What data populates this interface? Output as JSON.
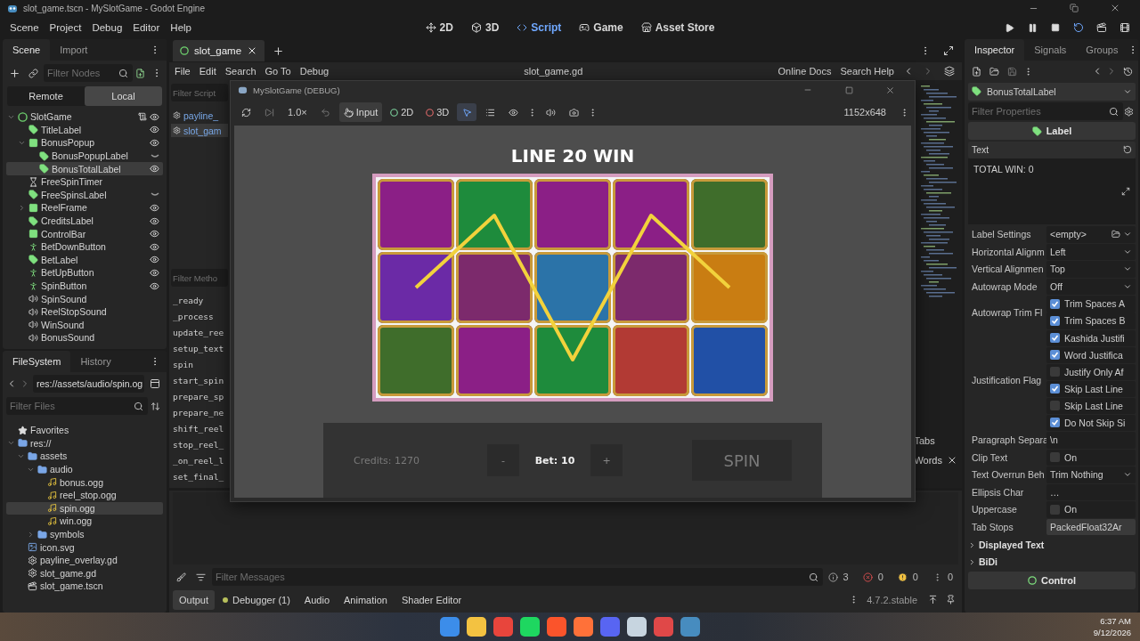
{
  "window": {
    "title": "slot_game.tscn - MySlotGame - Godot Engine"
  },
  "menu": [
    "Scene",
    "Project",
    "Debug",
    "Editor",
    "Help"
  ],
  "workspaces": [
    {
      "label": "2D",
      "kind": "planar",
      "selected": false
    },
    {
      "label": "3D",
      "kind": "spatial",
      "selected": false
    },
    {
      "label": "Script",
      "kind": "script",
      "selected": true
    },
    {
      "label": "Game",
      "kind": "game",
      "selected": false
    },
    {
      "label": "Asset Store",
      "kind": "store",
      "selected": false
    }
  ],
  "scene_dock": {
    "tabs": [
      {
        "label": "Scene",
        "selected": true
      },
      {
        "label": "Import",
        "selected": false
      }
    ],
    "filter_placeholder": "Filter Nodes",
    "modes": [
      {
        "label": "Remote",
        "selected": false
      },
      {
        "label": "Local",
        "selected": true
      }
    ],
    "tree": [
      {
        "name": "SlotGame",
        "kind": "root",
        "script": true,
        "visible": true,
        "expanded": true,
        "selected": false,
        "children": [
          {
            "name": "TitleLabel",
            "kind": "label",
            "visible": true,
            "selected": false
          },
          {
            "name": "BonusPopup",
            "kind": "control",
            "visible": true,
            "expanded": true,
            "selected": false,
            "children": [
              {
                "name": "BonusPopupLabel",
                "kind": "label",
                "visible": false,
                "selected": false
              },
              {
                "name": "BonusTotalLabel",
                "kind": "label",
                "visible": true,
                "selected": true
              }
            ]
          },
          {
            "name": "FreeSpinTimer",
            "kind": "timer",
            "selected": false
          },
          {
            "name": "FreeSpinsLabel",
            "kind": "label",
            "visible": false,
            "selected": false
          },
          {
            "name": "ReelFrame",
            "kind": "control",
            "visible": true,
            "expanded": false,
            "selected": false
          },
          {
            "name": "CreditsLabel",
            "kind": "label",
            "visible": true,
            "selected": false
          },
          {
            "name": "ControlBar",
            "kind": "control",
            "visible": true,
            "selected": false
          },
          {
            "name": "BetDownButton",
            "kind": "button",
            "visible": true,
            "selected": false
          },
          {
            "name": "BetLabel",
            "kind": "label",
            "visible": true,
            "selected": false
          },
          {
            "name": "BetUpButton",
            "kind": "button",
            "visible": true,
            "selected": false
          },
          {
            "name": "SpinButton",
            "kind": "button",
            "visible": true,
            "selected": false
          },
          {
            "name": "SpinSound",
            "kind": "sound",
            "selected": false
          },
          {
            "name": "ReelStopSound",
            "kind": "sound",
            "selected": false
          },
          {
            "name": "WinSound",
            "kind": "sound",
            "selected": false
          },
          {
            "name": "BonusSound",
            "kind": "sound",
            "selected": false
          }
        ]
      }
    ]
  },
  "file_dock": {
    "tabs": [
      {
        "label": "FileSystem",
        "selected": true
      },
      {
        "label": "History",
        "selected": false
      }
    ],
    "path": "res://assets/audio/spin.og",
    "filter_placeholder": "Filter Files",
    "tree": [
      {
        "name": "Favorites",
        "kind": "favorites",
        "selected": false
      },
      {
        "name": "res://",
        "kind": "folder",
        "expanded": true,
        "selected": false,
        "children": [
          {
            "name": "assets",
            "kind": "folder",
            "expanded": true,
            "selected": false,
            "children": [
              {
                "name": "audio",
                "kind": "folder",
                "expanded": true,
                "selected": false,
                "children": [
                  {
                    "name": "bonus.ogg",
                    "kind": "audio",
                    "selected": false
                  },
                  {
                    "name": "reel_stop.ogg",
                    "kind": "audio",
                    "selected": false
                  },
                  {
                    "name": "spin.ogg",
                    "kind": "audio",
                    "selected": true
                  },
                  {
                    "name": "win.ogg",
                    "kind": "audio",
                    "selected": false
                  }
                ]
              },
              {
                "name": "symbols",
                "kind": "folder",
                "expanded": false,
                "selected": false
              }
            ]
          },
          {
            "name": "icon.svg",
            "kind": "image",
            "selected": false
          },
          {
            "name": "payline_overlay.gd",
            "kind": "script",
            "selected": false
          },
          {
            "name": "slot_game.gd",
            "kind": "script",
            "selected": false
          },
          {
            "name": "slot_game.tscn",
            "kind": "scene",
            "selected": false
          }
        ]
      }
    ]
  },
  "script_editor": {
    "tabs": [
      {
        "label": "slot_game",
        "selected": true
      }
    ],
    "menu": [
      "File",
      "Edit",
      "Search",
      "Go To",
      "Debug"
    ],
    "file_name": "slot_game.gd",
    "help": [
      "Online Docs",
      "Search Help"
    ],
    "scripts_filter": {
      "placeholder": "Filter Script"
    },
    "scripts": [
      {
        "name": "payline_",
        "selected": false
      },
      {
        "name": "slot_gam",
        "selected": true
      }
    ],
    "methods_filter": {
      "placeholder": "Filter Metho"
    },
    "methods": [
      "_ready",
      "_process",
      "update_ree",
      "setup_text",
      "spin",
      "start_spin",
      "prepare_sp",
      "prepare_ne",
      "shift_reel",
      "stop_reel_",
      "_on_reel_l",
      "set_final_"
    ],
    "find_bar": {
      "tabs_label": "Tabs",
      "words_label": "Words"
    }
  },
  "game_window": {
    "title": "MySlotGame (DEBUG)",
    "zoom": "1.0×",
    "modes": [
      {
        "label": "Input",
        "kind": "input",
        "selected": true
      },
      {
        "label": "2D",
        "kind": "planar",
        "selected": false
      },
      {
        "label": "3D",
        "kind": "spatial",
        "selected": false
      }
    ],
    "resolution": "1152x648",
    "heading": "LINE 20 WIN",
    "reels": [
      [
        {
          "kind": "a"
        },
        {
          "kind": "q"
        },
        {
          "kind": "a"
        },
        {
          "kind": "a"
        },
        {
          "kind": "scatter"
        }
      ],
      [
        {
          "kind": "wild"
        },
        {
          "kind": "paw"
        },
        {
          "kind": "fish"
        },
        {
          "kind": "paw"
        },
        {
          "kind": "ten"
        }
      ],
      [
        {
          "kind": "scatter"
        },
        {
          "kind": "a"
        },
        {
          "kind": "q"
        },
        {
          "kind": "cat"
        },
        {
          "kind": "k"
        }
      ]
    ],
    "credits": "Credits: 1270",
    "bet_down": "-",
    "bet": "Bet: 10",
    "bet_up": "+",
    "spin": "SPIN"
  },
  "output": {
    "filter_placeholder": "Filter Messages",
    "counts": [
      {
        "kind": "info",
        "count": "3"
      },
      {
        "kind": "error",
        "count": "0"
      },
      {
        "kind": "warning",
        "count": "0"
      },
      {
        "kind": "verbose",
        "count": "0"
      }
    ],
    "tabs": [
      {
        "label": "Output",
        "selected": true,
        "indicator": false
      },
      {
        "label": "Debugger (1)",
        "selected": false,
        "indicator": true
      },
      {
        "label": "Audio",
        "selected": false,
        "indicator": false
      },
      {
        "label": "Animation",
        "selected": false,
        "indicator": false
      },
      {
        "label": "Shader Editor",
        "selected": false,
        "indicator": false
      }
    ],
    "version": "4.7.2.stable"
  },
  "inspector": {
    "tabs": [
      {
        "label": "Inspector",
        "selected": true
      },
      {
        "label": "Signals",
        "selected": false
      },
      {
        "label": "Groups",
        "selected": false
      }
    ],
    "node": "BonusTotalLabel",
    "filter_placeholder": "Filter Properties",
    "section": "Label",
    "text_name": "Text",
    "text_value": "TOTAL WIN: 0",
    "properties": [
      {
        "name": "Label Settings",
        "kind": "resource_picker",
        "value": "<empty>"
      },
      {
        "name": "Horizontal Alignm",
        "kind": "dropdown",
        "value": "Left"
      },
      {
        "name": "Vertical Alignmen",
        "kind": "dropdown",
        "value": "Top"
      },
      {
        "name": "Autowrap Mode",
        "kind": "dropdown",
        "value": "Off"
      },
      {
        "name": "Autowrap Trim Fl",
        "kind": "flags",
        "options": [
          {
            "label": "Trim Spaces A",
            "checked": true
          },
          {
            "label": "Trim Spaces B",
            "checked": true
          }
        ]
      },
      {
        "name": "Justification Flag",
        "kind": "flags",
        "options": [
          {
            "label": "Kashida Justifi",
            "checked": true
          },
          {
            "label": "Word Justifica",
            "checked": true
          },
          {
            "label": "Justify Only Af",
            "checked": false
          },
          {
            "label": "Skip Last Line",
            "checked": true
          },
          {
            "label": "Skip Last Line",
            "checked": false
          },
          {
            "label": "Do Not Skip Si",
            "checked": true
          }
        ]
      },
      {
        "name": "Paragraph Separa",
        "kind": "text",
        "value": "\\n"
      },
      {
        "name": "Clip Text",
        "kind": "check",
        "label": "On",
        "checked": false
      },
      {
        "name": "Text Overrun Beh",
        "kind": "dropdown",
        "value": "Trim Nothing"
      },
      {
        "name": "Ellipsis Char",
        "kind": "text",
        "value": "…"
      },
      {
        "name": "Uppercase",
        "kind": "check",
        "label": "On",
        "checked": false
      },
      {
        "name": "Tab Stops",
        "kind": "resource",
        "value": "PackedFloat32Ar"
      }
    ],
    "collapsed_sections": [
      "Displayed Text",
      "BiDi"
    ],
    "next_section": "Control"
  },
  "taskbar": {
    "apps": [
      {
        "color": "#3c8dea"
      },
      {
        "color": "#f3c241"
      },
      {
        "color": "#e8453c"
      },
      {
        "color": "#1ed760"
      },
      {
        "color": "#fb542b"
      },
      {
        "color": "#ff7139"
      },
      {
        "color": "#5865f2"
      },
      {
        "color": "#c7d5e0"
      },
      {
        "color": "#e04848"
      },
      {
        "color": "#478cbf"
      }
    ],
    "time": "6:37 AM",
    "date": "9/12/2026"
  }
}
